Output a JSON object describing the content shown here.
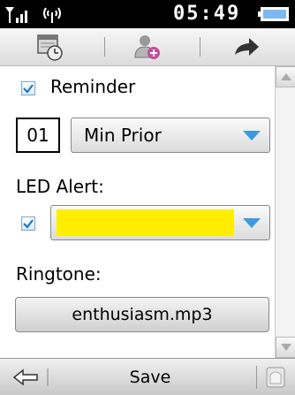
{
  "status": {
    "time": "05:49"
  },
  "tabs": [
    {
      "icon": "calendar-clock-icon"
    },
    {
      "icon": "add-contact-icon"
    },
    {
      "icon": "share-arrow-icon"
    }
  ],
  "reminder": {
    "label": "Reminder",
    "checked": true
  },
  "prior": {
    "value": "01",
    "unit_label": "Min Prior"
  },
  "led": {
    "label": "LED Alert:",
    "checked": true,
    "color": "#ffee00"
  },
  "ringtone": {
    "label": "Ringtone:",
    "value": "enthusiasm.mp3"
  },
  "bottom": {
    "back_icon": "back-arrow-icon",
    "save_label": "Save",
    "home_icon": "home-icon"
  }
}
